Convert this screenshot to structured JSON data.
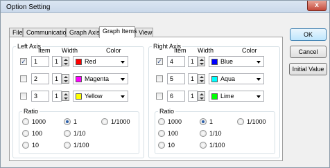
{
  "window": {
    "title": "Option Setting",
    "close": "x"
  },
  "tabs": [
    "File",
    "Communication",
    "Graph Axis",
    "Graph Items",
    "View"
  ],
  "buttons": {
    "ok": "OK",
    "cancel": "Cancel",
    "initial_value": "Initial Value"
  },
  "left_axis": {
    "title": "Left Axis",
    "headers": {
      "item": "Item",
      "width": "Width",
      "color": "Color"
    },
    "rows": [
      {
        "checked": true,
        "item": "1",
        "width": "1",
        "color_name": "Red",
        "color": "#ff0000"
      },
      {
        "checked": false,
        "item": "2",
        "width": "1",
        "color_name": "Magenta",
        "color": "#ff00ff"
      },
      {
        "checked": false,
        "item": "3",
        "width": "1",
        "color_name": "Yellow",
        "color": "#ffff00"
      }
    ],
    "ratio_label": "Ratio",
    "ratio_options": [
      "1000",
      "1",
      "1/1000",
      "100",
      "1/10",
      "10",
      "1/100"
    ],
    "ratio_selected": "1"
  },
  "right_axis": {
    "title": "Right Axis",
    "headers": {
      "item": "Item",
      "width": "Width",
      "color": "Color"
    },
    "rows": [
      {
        "checked": true,
        "item": "4",
        "width": "1",
        "color_name": "Blue",
        "color": "#0000ff"
      },
      {
        "checked": false,
        "item": "5",
        "width": "1",
        "color_name": "Aqua",
        "color": "#00ffff"
      },
      {
        "checked": false,
        "item": "6",
        "width": "1",
        "color_name": "Lime",
        "color": "#00ff00"
      }
    ],
    "ratio_label": "Ratio",
    "ratio_options": [
      "1000",
      "1",
      "1/1000",
      "100",
      "1/10",
      "10",
      "1/100"
    ],
    "ratio_selected": "1"
  }
}
